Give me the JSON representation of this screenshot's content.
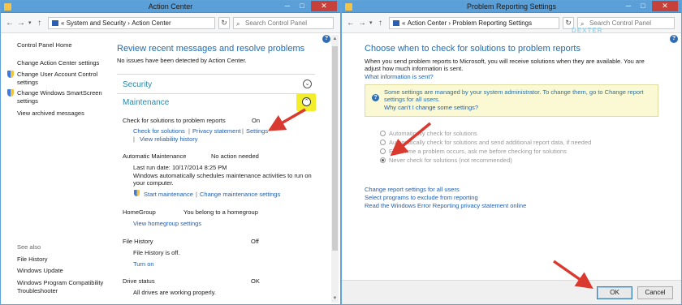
{
  "left_window": {
    "title": "Action Center",
    "controls": {
      "minimize": "─",
      "maximize": "□",
      "close": "✕"
    },
    "breadcrumb": [
      "«",
      "System and Security",
      "›",
      "Action Center"
    ],
    "search_placeholder": "Search Control Panel",
    "sidebar": {
      "home": "Control Panel Home",
      "items": [
        "Change Action Center settings",
        "Change User Account Control settings",
        "Change Windows SmartScreen settings",
        "View archived messages"
      ],
      "see_also_title": "See also",
      "see_also": [
        "File History",
        "Windows Update",
        "Windows Program Compatibility Troubleshooter"
      ]
    },
    "main": {
      "heading": "Review recent messages and resolve problems",
      "subtext": "No issues have been detected by Action Center.",
      "security": "Security",
      "maintenance": "Maintenance",
      "check_solutions": {
        "label": "Check for solutions to problem reports",
        "status": "On",
        "link1": "Check for solutions",
        "link2": "Privacy statement",
        "link3": "Settings",
        "link4": "View reliability history"
      },
      "auto_maint": {
        "label": "Automatic Maintenance",
        "status": "No action needed",
        "last_run": "Last run date: 10/17/2014 8:25 PM",
        "desc": "Windows automatically schedules maintenance activities to run on",
        "desc2": "your computer.",
        "link1": "Start maintenance",
        "link2": "Change maintenance settings"
      },
      "homegroup": {
        "label": "HomeGroup",
        "status": "You belong to a homegroup",
        "link": "View homegroup settings"
      },
      "file_history": {
        "label": "File History",
        "status": "Off",
        "desc": "File History is off.",
        "link": "Turn on"
      },
      "drive_status": {
        "label": "Drive status",
        "status": "OK",
        "desc": "All drives are working properly."
      }
    }
  },
  "right_window": {
    "title": "Problem Reporting Settings",
    "controls": {
      "minimize": "─",
      "maximize": "□",
      "close": "✕"
    },
    "breadcrumb": [
      "«",
      "Action Center",
      "›",
      "Problem Reporting Settings"
    ],
    "search_placeholder": "Search Control Panel",
    "heading": "Choose when to check for solutions to problem reports",
    "intro": "When you send problem reports to Microsoft, you will receive solutions when they are available. You are",
    "intro2": "adjust how much information is sent.",
    "info_link": "What information is sent?",
    "managed_text": "Some settings are managed by your system administrator. To change them, go to Change report",
    "managed_text2": "settings for all users.",
    "managed_link": "Why can't I change some settings?",
    "options": [
      "Automatically check for solutions",
      "Automatically check for solutions and send additional report data, if needed",
      "Each time a problem occurs, ask me before checking for solutions",
      "Never check for solutions (not recommended)"
    ],
    "selected_option": 3,
    "links": [
      "Change report settings for all users",
      "Select programs to exclude from reporting",
      "Read the Windows Error Reporting privacy statement online"
    ],
    "ok": "OK",
    "cancel": "Cancel",
    "watermark": "DEXTER"
  },
  "colors": {
    "titlebar": "#5a9fd8",
    "link": "#1f5fb0",
    "section": "#2a88a8",
    "arrow": "#d9392f",
    "highlight": "#f3ee2a"
  }
}
